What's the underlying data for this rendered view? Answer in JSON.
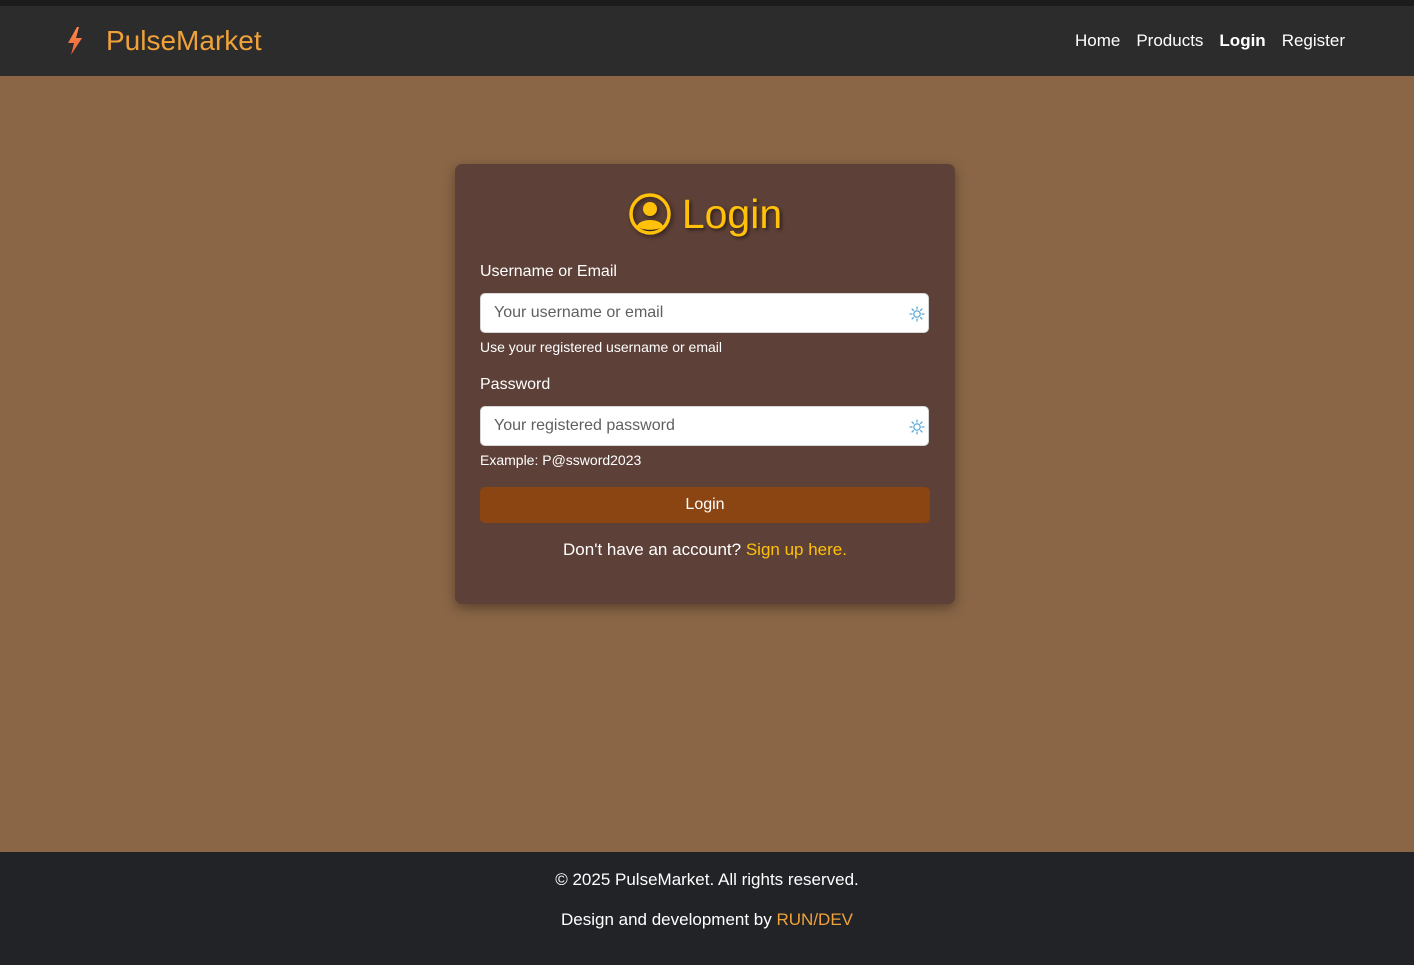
{
  "brand": {
    "name": "PulseMarket",
    "icon": "lightning-bolt-icon",
    "color": "#f0a23a"
  },
  "nav": {
    "items": [
      {
        "label": "Home",
        "active": false
      },
      {
        "label": "Products",
        "active": false
      },
      {
        "label": "Login",
        "active": true
      },
      {
        "label": "Register",
        "active": false
      }
    ]
  },
  "login": {
    "title": "Login",
    "title_icon": "user-circle-icon",
    "username": {
      "label": "Username or Email",
      "placeholder": "Your username or email",
      "value": "",
      "hint": "Use your registered username or email"
    },
    "password": {
      "label": "Password",
      "placeholder": "Your registered password",
      "value": "",
      "hint": "Example: P@ssword2023"
    },
    "submit_label": "Login",
    "signup_prompt": "Don't have an account?",
    "signup_link": "Sign up here."
  },
  "footer": {
    "copyright": "© 2025 PulseMarket. All rights reserved.",
    "credit_prefix": "Design and development by",
    "credit_link": "RUN/DEV"
  },
  "colors": {
    "page_bg": "#8a6647",
    "navbar_bg": "#2c2c2d",
    "card_bg": "#5d4037",
    "accent": "#ffc10a",
    "button_bg": "#8b4513",
    "footer_bg": "#212327"
  }
}
